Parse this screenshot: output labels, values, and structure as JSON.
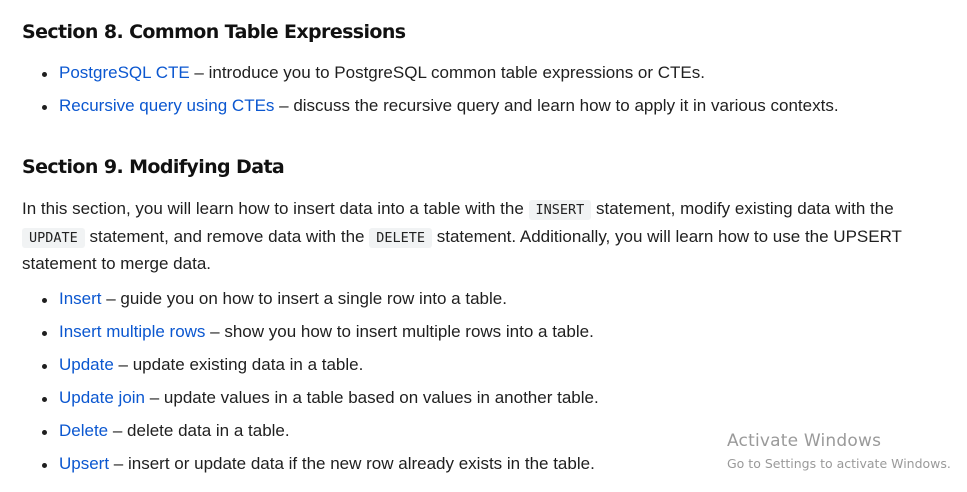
{
  "section8": {
    "title": "Section 8. Common Table Expressions",
    "items": [
      {
        "link": "PostgreSQL CTE",
        "desc": " – introduce you to PostgreSQL common table expressions or CTEs."
      },
      {
        "link": "Recursive query using CTEs",
        "desc": " – discuss the recursive query and learn how to apply it in various contexts."
      }
    ]
  },
  "section9": {
    "title": "Section 9. Modifying Data",
    "intro": {
      "t1": "In this section, you will learn how to insert data into a table with the ",
      "code1": "INSERT",
      "t2": " statement, modify existing data with the ",
      "code2": "UPDATE",
      "t3": " statement, and remove data with the ",
      "code3": "DELETE",
      "t4": " statement. Additionally, you will learn how to use the UPSERT statement to merge data."
    },
    "items": [
      {
        "link": "Insert",
        "desc": " – guide you on how to insert a single row into a table."
      },
      {
        "link": "Insert multiple rows",
        "desc": " – show you how to insert multiple rows into a table."
      },
      {
        "link": "Update",
        "desc": " – update existing data in a table."
      },
      {
        "link": "Update join",
        "desc": " – update values in a table based on values in another table."
      },
      {
        "link": "Delete",
        "desc": " – delete data in a table."
      },
      {
        "link": "Upsert",
        "desc": " – insert or update data if the new row already exists in the table."
      }
    ]
  },
  "watermark": {
    "title": "Activate Windows",
    "subtitle": "Go to Settings to activate Windows."
  },
  "colors": {
    "link": "#0b57d0",
    "text": "#1f1f1f",
    "code_bg": "#f1f3f4",
    "watermark": "#9a9a9a"
  }
}
